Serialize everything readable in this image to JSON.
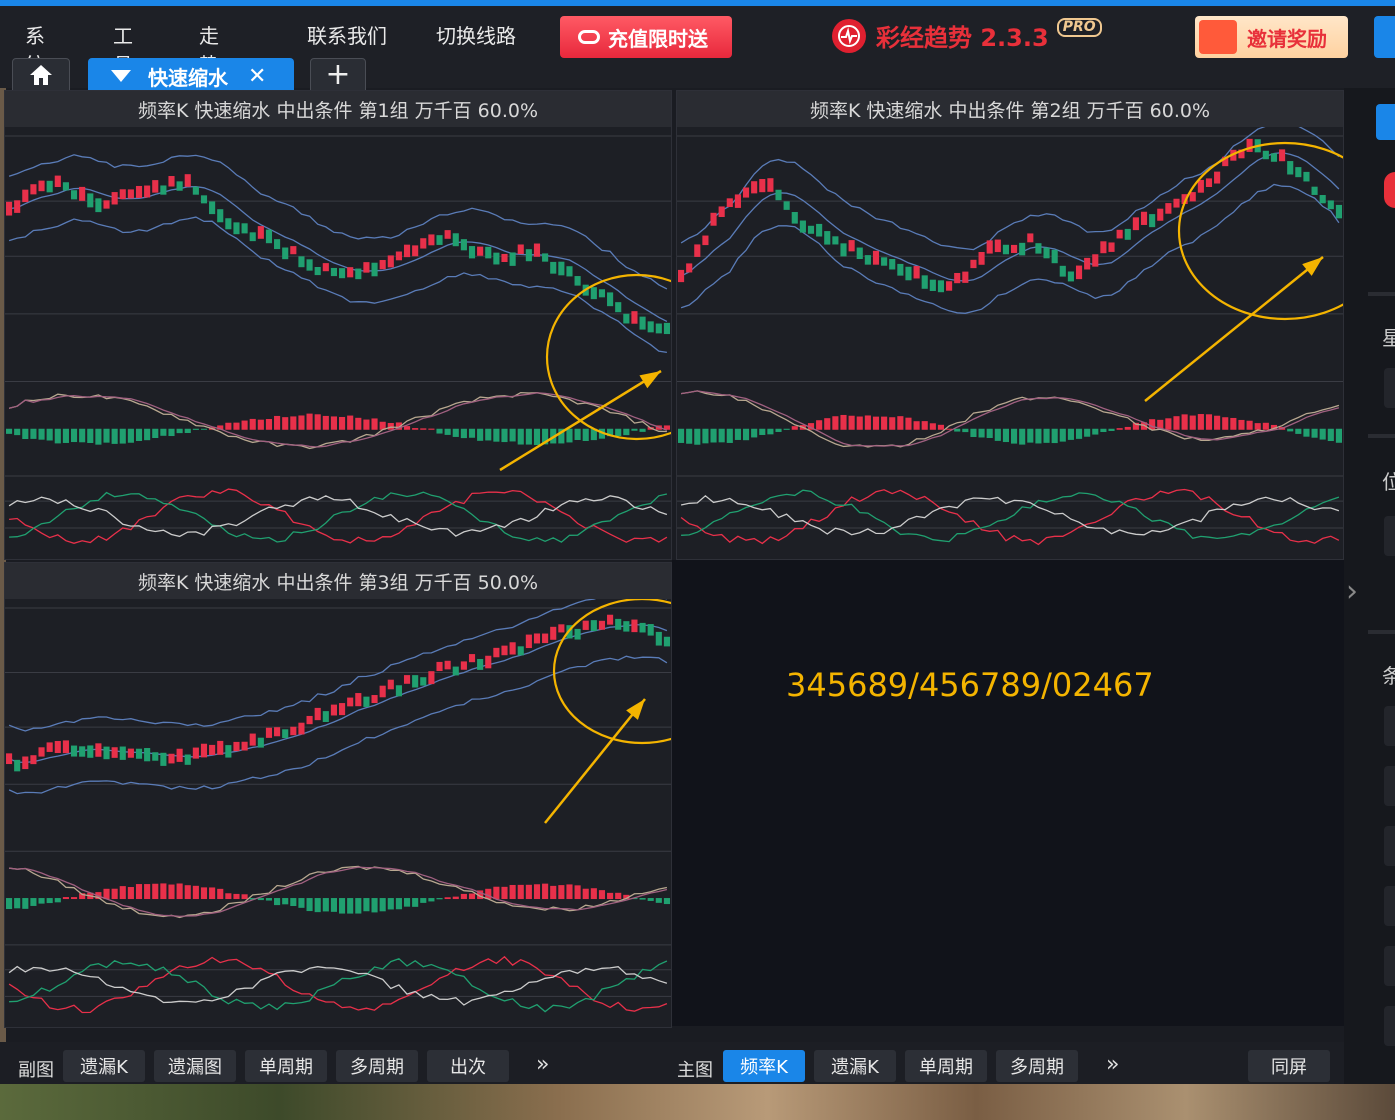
{
  "menu": {
    "items": [
      "系统",
      "工具",
      "走势图",
      "联系我们",
      "切换线路"
    ]
  },
  "promo": {
    "label": "充值限时送"
  },
  "brand": {
    "name": "彩经趋势 2.3.3",
    "badge": "PRO"
  },
  "invite": {
    "label": "邀请奖励"
  },
  "tabs": {
    "active_label": "快速缩水",
    "close": "✕",
    "add": "+"
  },
  "panels": [
    {
      "title": "频率K 快速缩水 中出条件 第1组 万千百 60.0%"
    },
    {
      "title": "频率K 快速缩水 中出条件 第2组 万千百 60.0%"
    },
    {
      "title": "频率K 快速缩水 中出条件 第3组 万千百 50.0%"
    }
  ],
  "annotation": {
    "text": "345689/456789/02467"
  },
  "bottom": {
    "sub_label": "副图",
    "sub_buttons": [
      "遗漏K",
      "遗漏图",
      "单周期",
      "多周期",
      "出次"
    ],
    "more": "»",
    "main_label": "主图",
    "main_buttons": [
      "频率K",
      "遗漏K",
      "单周期",
      "多周期"
    ],
    "same_screen": "同屏"
  },
  "right_strip": {
    "chars": [
      "星",
      "位",
      "条"
    ]
  },
  "colors": {
    "accent": "#1a86e8",
    "up": "#e8304a",
    "down": "#20a070",
    "highlight": "#f4b400"
  }
}
